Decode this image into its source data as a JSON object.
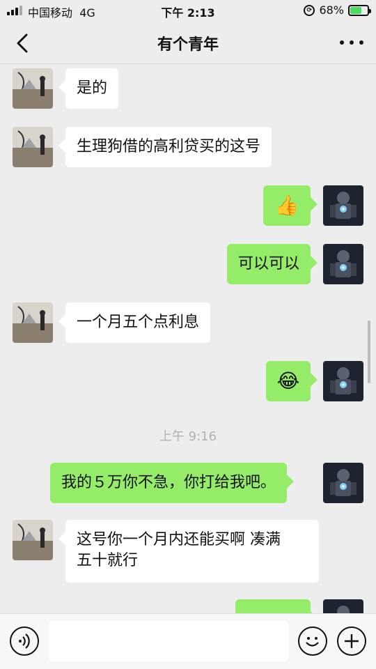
{
  "status_bar": {
    "carrier": "中国移动",
    "network": "4G",
    "time": "下午 2:13",
    "battery": "68%",
    "battery_level": 0.68
  },
  "nav": {
    "title": "有个青年",
    "back_icon": "chevron-left-icon",
    "more_icon": "more-dots-icon"
  },
  "messages": [
    {
      "side": "in",
      "text": "是的"
    },
    {
      "side": "in",
      "text": "生理狗借的高利贷买的这号"
    },
    {
      "side": "out",
      "text": "👍"
    },
    {
      "side": "out",
      "text": "可以可以"
    },
    {
      "side": "in",
      "text": "一个月五个点利息"
    },
    {
      "side": "out",
      "text": "😂"
    },
    {
      "timestamp": "上午 9:16"
    },
    {
      "side": "out",
      "text": "我的５万你不急，你打给我吧。"
    },
    {
      "side": "in",
      "text": "这号你一个月内还能买啊 凑满",
      "text2": "五十就行"
    }
  ],
  "input_bar": {
    "voice_icon": "voice-icon",
    "emoji_icon": "emoji-icon",
    "plus_icon": "plus-icon",
    "placeholder": ""
  },
  "colors": {
    "outgoing_bubble": "#95ec69",
    "incoming_bubble": "#ffffff",
    "background": "#ededed"
  }
}
